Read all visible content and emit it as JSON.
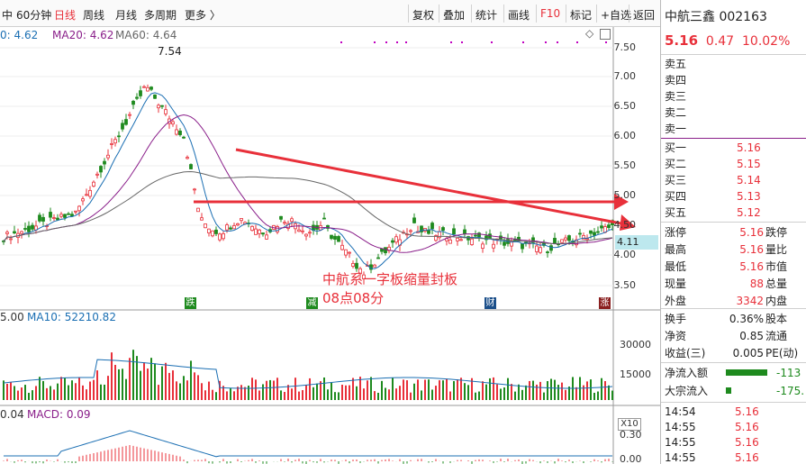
{
  "toolbar": {
    "left_items": [
      "中",
      "60分钟",
      "日线",
      "周线",
      "月线",
      "多周期",
      "更多 〉"
    ],
    "right_items": [
      "复权",
      "叠加",
      "统计",
      "画线",
      "F10",
      "标记",
      "+自选",
      "返回"
    ],
    "active_item": "日线",
    "accent": "#e8303a"
  },
  "legend_main": {
    "ma5": "0: 4.62",
    "ma20": "MA20: 4.62",
    "ma60": "MA60: 4.64",
    "ma5_color": "#1b6fb3",
    "ma20_color": "#8a1f8a",
    "ma60_color": "#666666"
  },
  "legend_vol": {
    "vol": "5.00",
    "ma10": "MA10: 52210.82"
  },
  "legend_macd": {
    "dif": "0.04",
    "macd": "MACD: 0.09"
  },
  "price_axis": [
    "7.50",
    "7.00",
    "6.50",
    "6.00",
    "5.50",
    "5.00",
    "4.50",
    "4.00",
    "3.50"
  ],
  "current_price_box": "4.11",
  "peak_label": "7.54",
  "vol_axis": [
    "30000",
    "15000"
  ],
  "vol_multiplier": "X10",
  "macd_axis": [
    "0.30",
    "0.00"
  ],
  "event_markers": [
    {
      "label": "跌",
      "color": "#1e8a1e"
    },
    {
      "label": "减",
      "color": "#1e8a1e"
    },
    {
      "label": "财",
      "color": "#1b4f8a"
    },
    {
      "label": "涨",
      "color": "#8a1f1f"
    }
  ],
  "annotation": {
    "line1": "中航系一字板缩量封板",
    "line2": "08点08分"
  },
  "stock": {
    "name": "中航三鑫",
    "code": "002163",
    "price": "5.16",
    "change": "0.47",
    "change_pct": "10.02%"
  },
  "sell_levels": [
    "卖五",
    "卖四",
    "卖三",
    "卖二",
    "卖一"
  ],
  "buy_levels": [
    {
      "label": "买一",
      "price": "5.16"
    },
    {
      "label": "买二",
      "price": "5.15"
    },
    {
      "label": "买三",
      "price": "5.14"
    },
    {
      "label": "买四",
      "price": "5.13"
    },
    {
      "label": "买五",
      "price": "5.12"
    }
  ],
  "stats": [
    {
      "l1": "涨停",
      "v1": "5.16",
      "l2": "跌停"
    },
    {
      "l1": "最高",
      "v1": "5.16",
      "l2": "量比"
    },
    {
      "l1": "最低",
      "v1": "5.16",
      "l2": "市值"
    },
    {
      "l1": "现量",
      "v1": "88",
      "l2": "总量"
    },
    {
      "l1": "外盘",
      "v1": "3342",
      "l2": "内盘"
    }
  ],
  "stats2": [
    {
      "l1": "换手",
      "v1": "0.36%",
      "l2": "股本"
    },
    {
      "l1": "净资",
      "v1": "0.85",
      "l2": "流通"
    },
    {
      "l1": "收益(三)",
      "v1": "0.005",
      "l2": "PE(动)"
    }
  ],
  "flows": [
    {
      "label": "净流入额",
      "value": "-113"
    },
    {
      "label": "大宗流入",
      "value": "-175."
    }
  ],
  "ticks": [
    {
      "time": "14:54",
      "price": "5.16"
    },
    {
      "time": "14:55",
      "price": "5.16"
    },
    {
      "time": "14:55",
      "price": "5.16"
    },
    {
      "time": "14:55",
      "price": "5.16"
    }
  ]
}
